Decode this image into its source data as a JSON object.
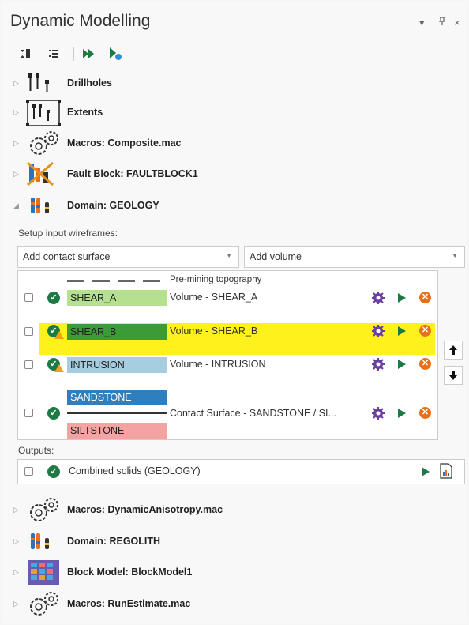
{
  "window": {
    "title": "Dynamic Modelling",
    "controls": {
      "dropdown": "▾",
      "pin": "⊥",
      "close": "×"
    }
  },
  "toolbar": {
    "icons": [
      "collapse-all-icon",
      "expand-all-icon",
      "run-all-icon",
      "run-selected-icon"
    ]
  },
  "tree": {
    "top_items": [
      {
        "label": "Drillholes",
        "icon": "drillholes-icon",
        "expanded": false
      },
      {
        "label": "Extents",
        "icon": "extents-icon",
        "expanded": false
      },
      {
        "label": "Macros: Composite.mac",
        "icon": "macro-gears-icon",
        "expanded": false
      },
      {
        "label": "Fault Block: FAULTBLOCK1",
        "icon": "fault-block-icon",
        "expanded": false
      },
      {
        "label": "Domain: GEOLOGY",
        "icon": "domain-icon",
        "expanded": true
      }
    ],
    "bottom_items": [
      {
        "label": "Macros: DynamicAnisotropy.mac",
        "icon": "macro-gears-icon",
        "expanded": false
      },
      {
        "label": "Domain: REGOLITH",
        "icon": "domain-icon",
        "expanded": false
      },
      {
        "label": "Block Model: BlockModel1",
        "icon": "block-model-icon",
        "expanded": false
      },
      {
        "label": "Macros: RunEstimate.mac",
        "icon": "macro-gears-icon",
        "expanded": false
      }
    ]
  },
  "domain": {
    "setup_label": "Setup input wireframes:",
    "add_contact": "Add contact surface",
    "add_volume": "Add volume",
    "topography_label": "Pre-mining topography",
    "rows": [
      {
        "name": "SHEAR_A",
        "desc": "Volume - SHEAR_A",
        "color": "#b5e08e",
        "warning": false,
        "highlighted": false
      },
      {
        "name": "SHEAR_B",
        "desc": "Volume - SHEAR_B",
        "color": "#3a9b37",
        "warning": true,
        "highlighted": true
      },
      {
        "name": "INTRUSION",
        "desc": "Volume - INTRUSION",
        "color": "#a7cde0",
        "warning": true,
        "highlighted": false
      }
    ],
    "contact": {
      "top": "SANDSTONE",
      "top_color": "#2f7fbf",
      "bottom": "SILTSTONE",
      "bottom_color": "#f4a3a3",
      "desc": "Contact Surface - SANDSTONE / SI..."
    },
    "outputs_label": "Outputs:",
    "output_item": "Combined solids (GEOLOGY)"
  },
  "colors": {
    "highlight": "#fff21c",
    "ok_green": "#1e7a45",
    "delete_orange": "#e8701c",
    "gear_purple": "#6b3fa0"
  }
}
